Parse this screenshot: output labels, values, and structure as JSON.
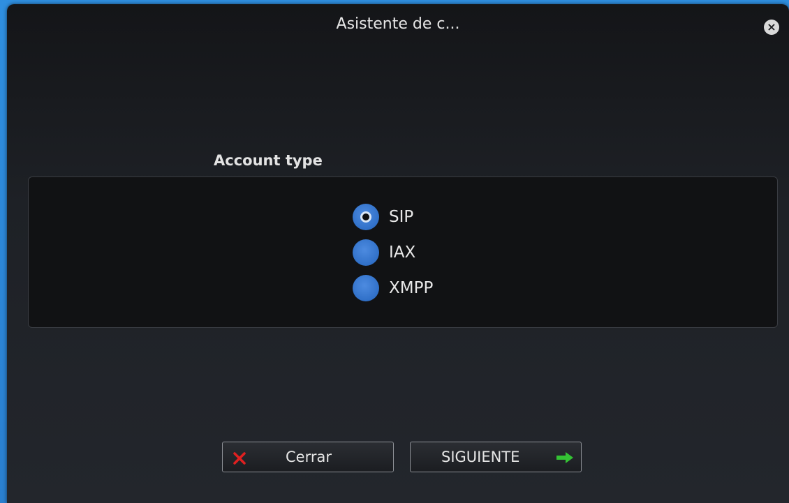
{
  "window": {
    "title": "Asistente de c...",
    "close_label": "×"
  },
  "section": {
    "label": "Account type"
  },
  "account_types": [
    {
      "label": "SIP",
      "checked": true
    },
    {
      "label": "IAX",
      "checked": false
    },
    {
      "label": "XMPP",
      "checked": false
    }
  ],
  "buttons": {
    "close_label": "Cerrar",
    "next_label": "SIGUIENTE"
  },
  "colors": {
    "accent": "#3070c8",
    "close_icon": "#e02020",
    "next_arrow": "#34c234"
  },
  "icons": {
    "close": "close-x-icon",
    "next": "arrow-right-icon",
    "window_close": "window-close-icon"
  }
}
